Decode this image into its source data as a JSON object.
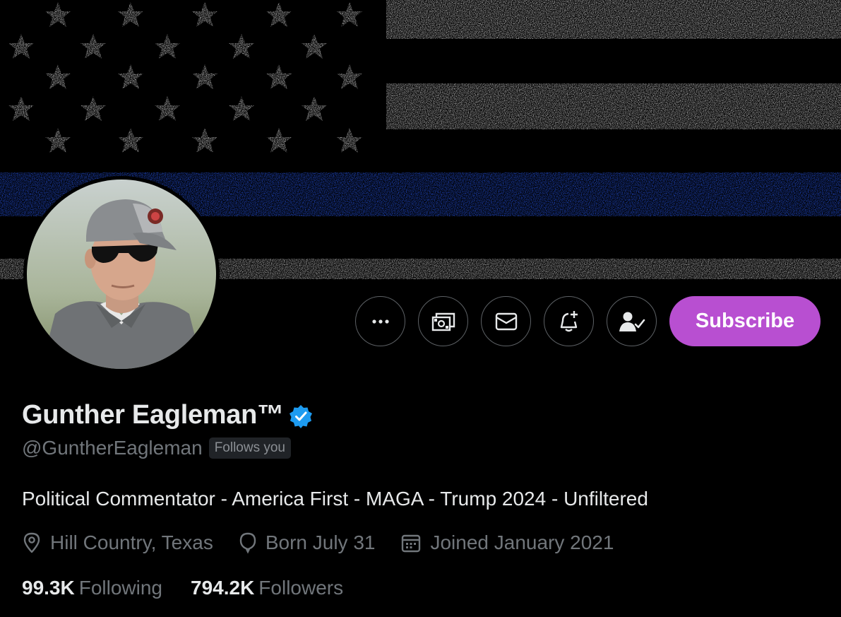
{
  "profile": {
    "display_name": "Gunther Eagleman™",
    "handle": "@GuntherEagleman",
    "follows_you": "Follows you",
    "verified_icon": "verified-badge-icon",
    "bio": "Political Commentator - America First - MAGA - Trump 2024 - Unfiltered",
    "location": "Hill Country, Texas",
    "birthday": "Born July 31",
    "joined": "Joined January 2021",
    "following_count": "99.3K",
    "following_label": "Following",
    "followers_count": "794.2K",
    "followers_label": "Followers"
  },
  "actions": {
    "more_icon": "more-options-icon",
    "tip_icon": "tip-money-icon",
    "message_icon": "envelope-icon",
    "notify_icon": "bell-plus-icon",
    "following_icon": "person-check-icon",
    "subscribe_label": "Subscribe"
  },
  "colors": {
    "background": "#000000",
    "primary_text": "#e7e9ea",
    "secondary_text": "#71767b",
    "subscribe_bg": "#b84fd1",
    "verified": "#1d9bf0",
    "banner_blue_line": "#1f4fd8"
  }
}
